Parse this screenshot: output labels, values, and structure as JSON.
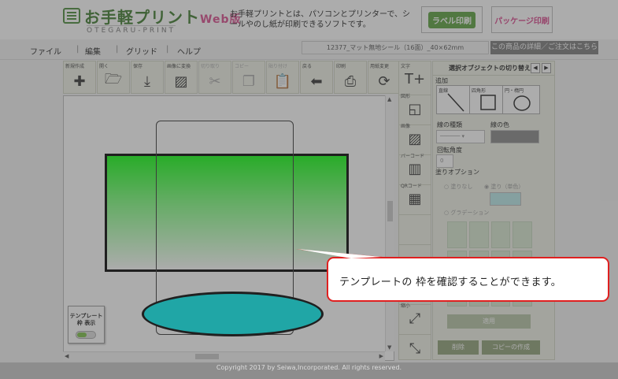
{
  "header": {
    "logo_title": "お手軽プリント",
    "logo_suffix": "Web版",
    "logo_sub": "OTEGARU-PRINT",
    "tagline": "お手軽プリントとは、パソコンとプリンターで、シールやのし紙が印刷できるソフトです。",
    "banner_label": "ラベル印刷",
    "banner_package": "パッケージ印刷"
  },
  "menu": {
    "items": [
      "ファイル",
      "編集",
      "グリッド",
      "ヘルプ"
    ],
    "document_name": "12377_マット無地シール（16面）_40×62mm",
    "detail_button": "この商品の詳細／ご注文はこちら"
  },
  "toolbar": {
    "tools": [
      {
        "label": "新規作成",
        "icon": "new-file-icon",
        "glyph": "✚",
        "enabled": true
      },
      {
        "label": "開く",
        "icon": "folder-icon",
        "glyph": "🗁",
        "enabled": true
      },
      {
        "label": "保存",
        "icon": "download-icon",
        "glyph": "⤓",
        "enabled": true
      },
      {
        "label": "画像に変換",
        "icon": "image-icon",
        "glyph": "▨",
        "enabled": true
      },
      {
        "label": "切り取り",
        "icon": "scissors-icon",
        "glyph": "✂",
        "enabled": false
      },
      {
        "label": "コピー",
        "icon": "copy-icon",
        "glyph": "❐",
        "enabled": false
      },
      {
        "label": "貼り付け",
        "icon": "paste-icon",
        "glyph": "📋",
        "enabled": false
      },
      {
        "label": "戻る",
        "icon": "back-arrow-icon",
        "glyph": "⬅",
        "enabled": true
      },
      {
        "label": "印刷",
        "icon": "printer-icon",
        "glyph": "⎙",
        "enabled": true
      },
      {
        "label": "用紙変更",
        "icon": "refresh-icon",
        "glyph": "⟳",
        "enabled": true
      }
    ]
  },
  "sidetools": {
    "tools": [
      {
        "label": "文字",
        "icon": "text-add-icon",
        "glyph": "T+"
      },
      {
        "label": "図形",
        "icon": "shape-icon",
        "glyph": "◱"
      },
      {
        "label": "画像",
        "icon": "picture-icon",
        "glyph": "▨"
      },
      {
        "label": "バーコード",
        "icon": "barcode-icon",
        "glyph": "▥"
      },
      {
        "label": "QRコード",
        "icon": "qrcode-icon",
        "glyph": "▦"
      },
      {
        "label": "",
        "icon": "blank-icon",
        "glyph": ""
      },
      {
        "label": "",
        "icon": "blank-icon",
        "glyph": ""
      },
      {
        "label": "",
        "icon": "blank-icon",
        "glyph": ""
      },
      {
        "label": "縮小",
        "icon": "shrink-icon",
        "glyph": "⤢"
      },
      {
        "label": "",
        "icon": "shrink-arrows-icon",
        "glyph": "⤡"
      }
    ]
  },
  "panel": {
    "title": "選択オブジェクトの切り替え",
    "add_label": "追加",
    "shapes": [
      {
        "label": "直線",
        "icon": "line-icon"
      },
      {
        "label": "四角形",
        "icon": "square-icon"
      },
      {
        "label": "円・楕円",
        "icon": "circle-icon"
      }
    ],
    "line_type_label": "線の種類",
    "line_color_label": "線の色",
    "rotation_label": "回転角度",
    "rotation_value": "0",
    "fill_option_label": "塗りオプション",
    "fill_none": "塗りなし",
    "fill_solid": "塗り（単色）",
    "fill_gradient": "グラデーション",
    "apply_button": "適用",
    "delete_button": "削除",
    "copy_button": "コピーの作成"
  },
  "canvas": {
    "template_toggle_label": "テンプレート枠 表示"
  },
  "callout": {
    "text": "テンプレートの 枠を確認することができます。"
  },
  "footer": {
    "copyright": "Copyright 2017 by Seiwa,Incorporated. All rights reserved."
  },
  "colors": {
    "brand_green": "#3d7a2c",
    "rect_gradient_top": "#11ff11",
    "ellipse_fill": "#00f4f4",
    "callout_border": "#e02020",
    "footer_bg": "#8d8d8d"
  }
}
